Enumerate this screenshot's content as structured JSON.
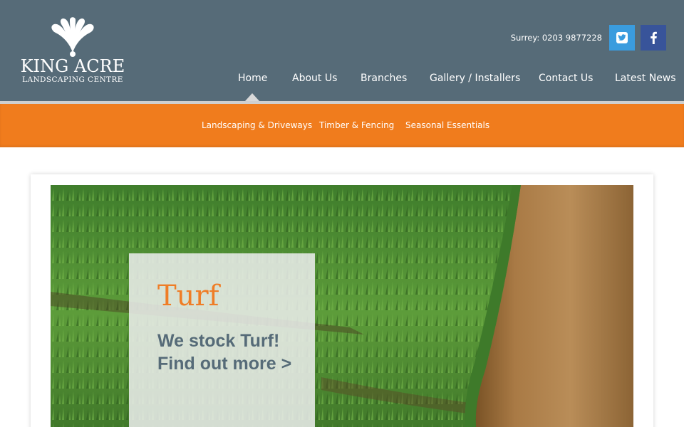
{
  "brand": {
    "name": "KING ACRE",
    "tagline": "LANDSCAPING CENTRE"
  },
  "contact": {
    "phone_text": "Surrey: 0203 9877228"
  },
  "social": {
    "twitter_icon": "twitter-bird-icon",
    "facebook_icon": "facebook-f-icon",
    "twitter_color": "#3a9cde",
    "facebook_color": "#38549a"
  },
  "nav": {
    "items": [
      {
        "label": "Home",
        "active": true
      },
      {
        "label": "About Us"
      },
      {
        "label": "Branches"
      },
      {
        "label": "Gallery / Installers"
      },
      {
        "label": "Contact Us"
      },
      {
        "label": "Latest News"
      }
    ]
  },
  "subnav": {
    "items": [
      {
        "label": "Landscaping & Driveways"
      },
      {
        "label": "Timber & Fencing"
      },
      {
        "label": "Seasonal Essentials"
      }
    ]
  },
  "hero": {
    "title": "Turf",
    "line1": "We stock Turf!",
    "line2": "Find out more >"
  },
  "colors": {
    "header": "#566b78",
    "accent": "#f07c1d",
    "title": "#ef7d26"
  }
}
